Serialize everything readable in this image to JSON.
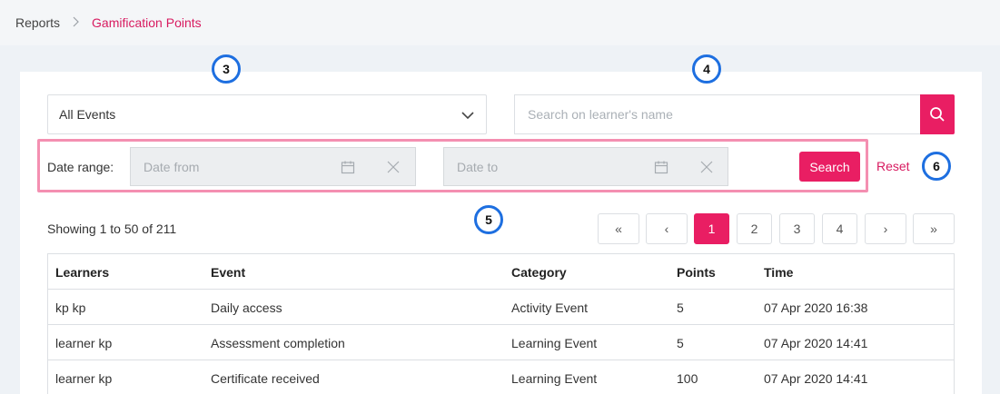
{
  "breadcrumb": {
    "root": "Reports",
    "separator": ">",
    "current": "Gamification Points"
  },
  "filters": {
    "event_select": {
      "value": "All Events"
    },
    "search": {
      "placeholder": "Search on learner's name"
    },
    "date_range": {
      "label": "Date range:",
      "from_placeholder": "Date from",
      "to_placeholder": "Date to"
    },
    "search_button": "Search",
    "reset_link": "Reset"
  },
  "markers": [
    "3",
    "4",
    "5",
    "6"
  ],
  "results": {
    "showing": "Showing 1 to 50 of 211",
    "pagination": {
      "first": "«",
      "prev": "‹",
      "pages": [
        "1",
        "2",
        "3",
        "4"
      ],
      "active_page": "1",
      "next": "›",
      "last": "»"
    }
  },
  "table": {
    "columns": [
      "Learners",
      "Event",
      "Category",
      "Points",
      "Time"
    ],
    "rows": [
      [
        "kp kp",
        "Daily access",
        "Activity Event",
        "5",
        "07 Apr 2020 16:38"
      ],
      [
        "learner kp",
        "Assessment completion",
        "Learning Event",
        "5",
        "07 Apr 2020 14:41"
      ],
      [
        "learner kp",
        "Certificate received",
        "Learning Event",
        "100",
        "07 Apr 2020 14:41"
      ]
    ]
  },
  "colors": {
    "accent": "#e91e63",
    "marker_ring": "#1e6fe0",
    "highlight_frame": "#f48fb1"
  },
  "icons": [
    "chevron-down-icon",
    "search-icon",
    "calendar-icon",
    "clear-icon",
    "chevron-right-icon"
  ]
}
